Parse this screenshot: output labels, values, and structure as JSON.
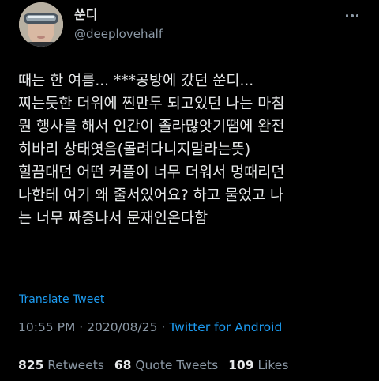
{
  "author": {
    "display_name": "쑨디",
    "handle": "@deeplovehalf",
    "avatar": "avatar-photo"
  },
  "more_icon": "more-horizontal-icon",
  "tweet": {
    "lines": [
      "때는 한 여름... ***공방에 갔던 쑨디...",
      "찌는듯한 더위에 찐만두 되고있던 나는 마침",
      "뭔 행사를 해서 인간이 졸라많앗기땜에 완전",
      "히바리 상태엿음(몰려다니지말라는뜻)",
      "힐끔대던 어떤 커플이 너무 더워서 멍때리던",
      "나한테 여기 왜 줄서있어요? 하고 물었고 나",
      "는 너무 짜증나서 문재인온다함"
    ]
  },
  "translate_label": "Translate Tweet",
  "meta": {
    "time": "10:55 PM",
    "date": "2020/08/25",
    "separator": "·",
    "source": "Twitter for Android"
  },
  "stats": {
    "retweets_count": "825",
    "retweets_label": "Retweets",
    "quotes_count": "68",
    "quotes_label": "Quote Tweets",
    "likes_count": "109",
    "likes_label": "Likes"
  },
  "colors": {
    "background": "#000000",
    "text": "#e7e9ea",
    "secondary": "#8b98a5",
    "accent": "#1d9bf0"
  }
}
